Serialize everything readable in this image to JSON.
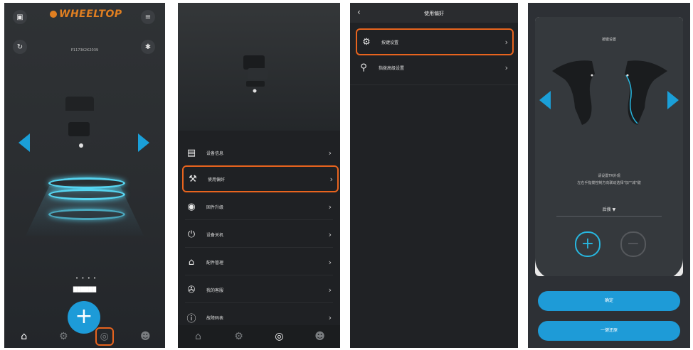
{
  "accent_color": "#1e9bd7",
  "highlight_color": "#e8641e",
  "phone1": {
    "brand": "WHEELTOP",
    "serial": "P1173K2K2039",
    "device_name": "██████",
    "page_dots": "• • • •",
    "top_icons": [
      "camera-icon",
      "menu-icon",
      "refresh-icon",
      "bluetooth-icon"
    ],
    "tabs": [
      "home-icon",
      "shifter-icon",
      "settings-icon",
      "profile-icon"
    ]
  },
  "phone2": {
    "menu": [
      {
        "label": "设备信息",
        "icon": "doc-icon"
      },
      {
        "label": "使用偏好",
        "icon": "bike-pref-icon",
        "highlighted": true
      },
      {
        "label": "固件升级",
        "icon": "record-icon"
      },
      {
        "label": "设备关机",
        "icon": "power-icon"
      },
      {
        "label": "配件管理",
        "icon": "store-icon"
      },
      {
        "label": "我的客服",
        "icon": "wrench-icon"
      },
      {
        "label": "故障码表",
        "icon": "alert-icon"
      }
    ],
    "tabs": [
      "home-icon",
      "shifter-icon",
      "settings-icon",
      "profile-icon"
    ]
  },
  "phone3": {
    "title": "使用偏好",
    "items": [
      {
        "label": "按键设置",
        "icon": "gear-icon",
        "highlighted": true
      },
      {
        "label": "指拨高级设置",
        "icon": "adjust-icon"
      }
    ]
  },
  "phone4": {
    "title": "按键设置",
    "desc_line1": "请设置TR外观",
    "desc_line2": "左右手指拨控制方向联动选择\"加\"\"减\"键",
    "selector": "后拨 ▼",
    "confirm": "确定",
    "secondary": "一键还原"
  }
}
